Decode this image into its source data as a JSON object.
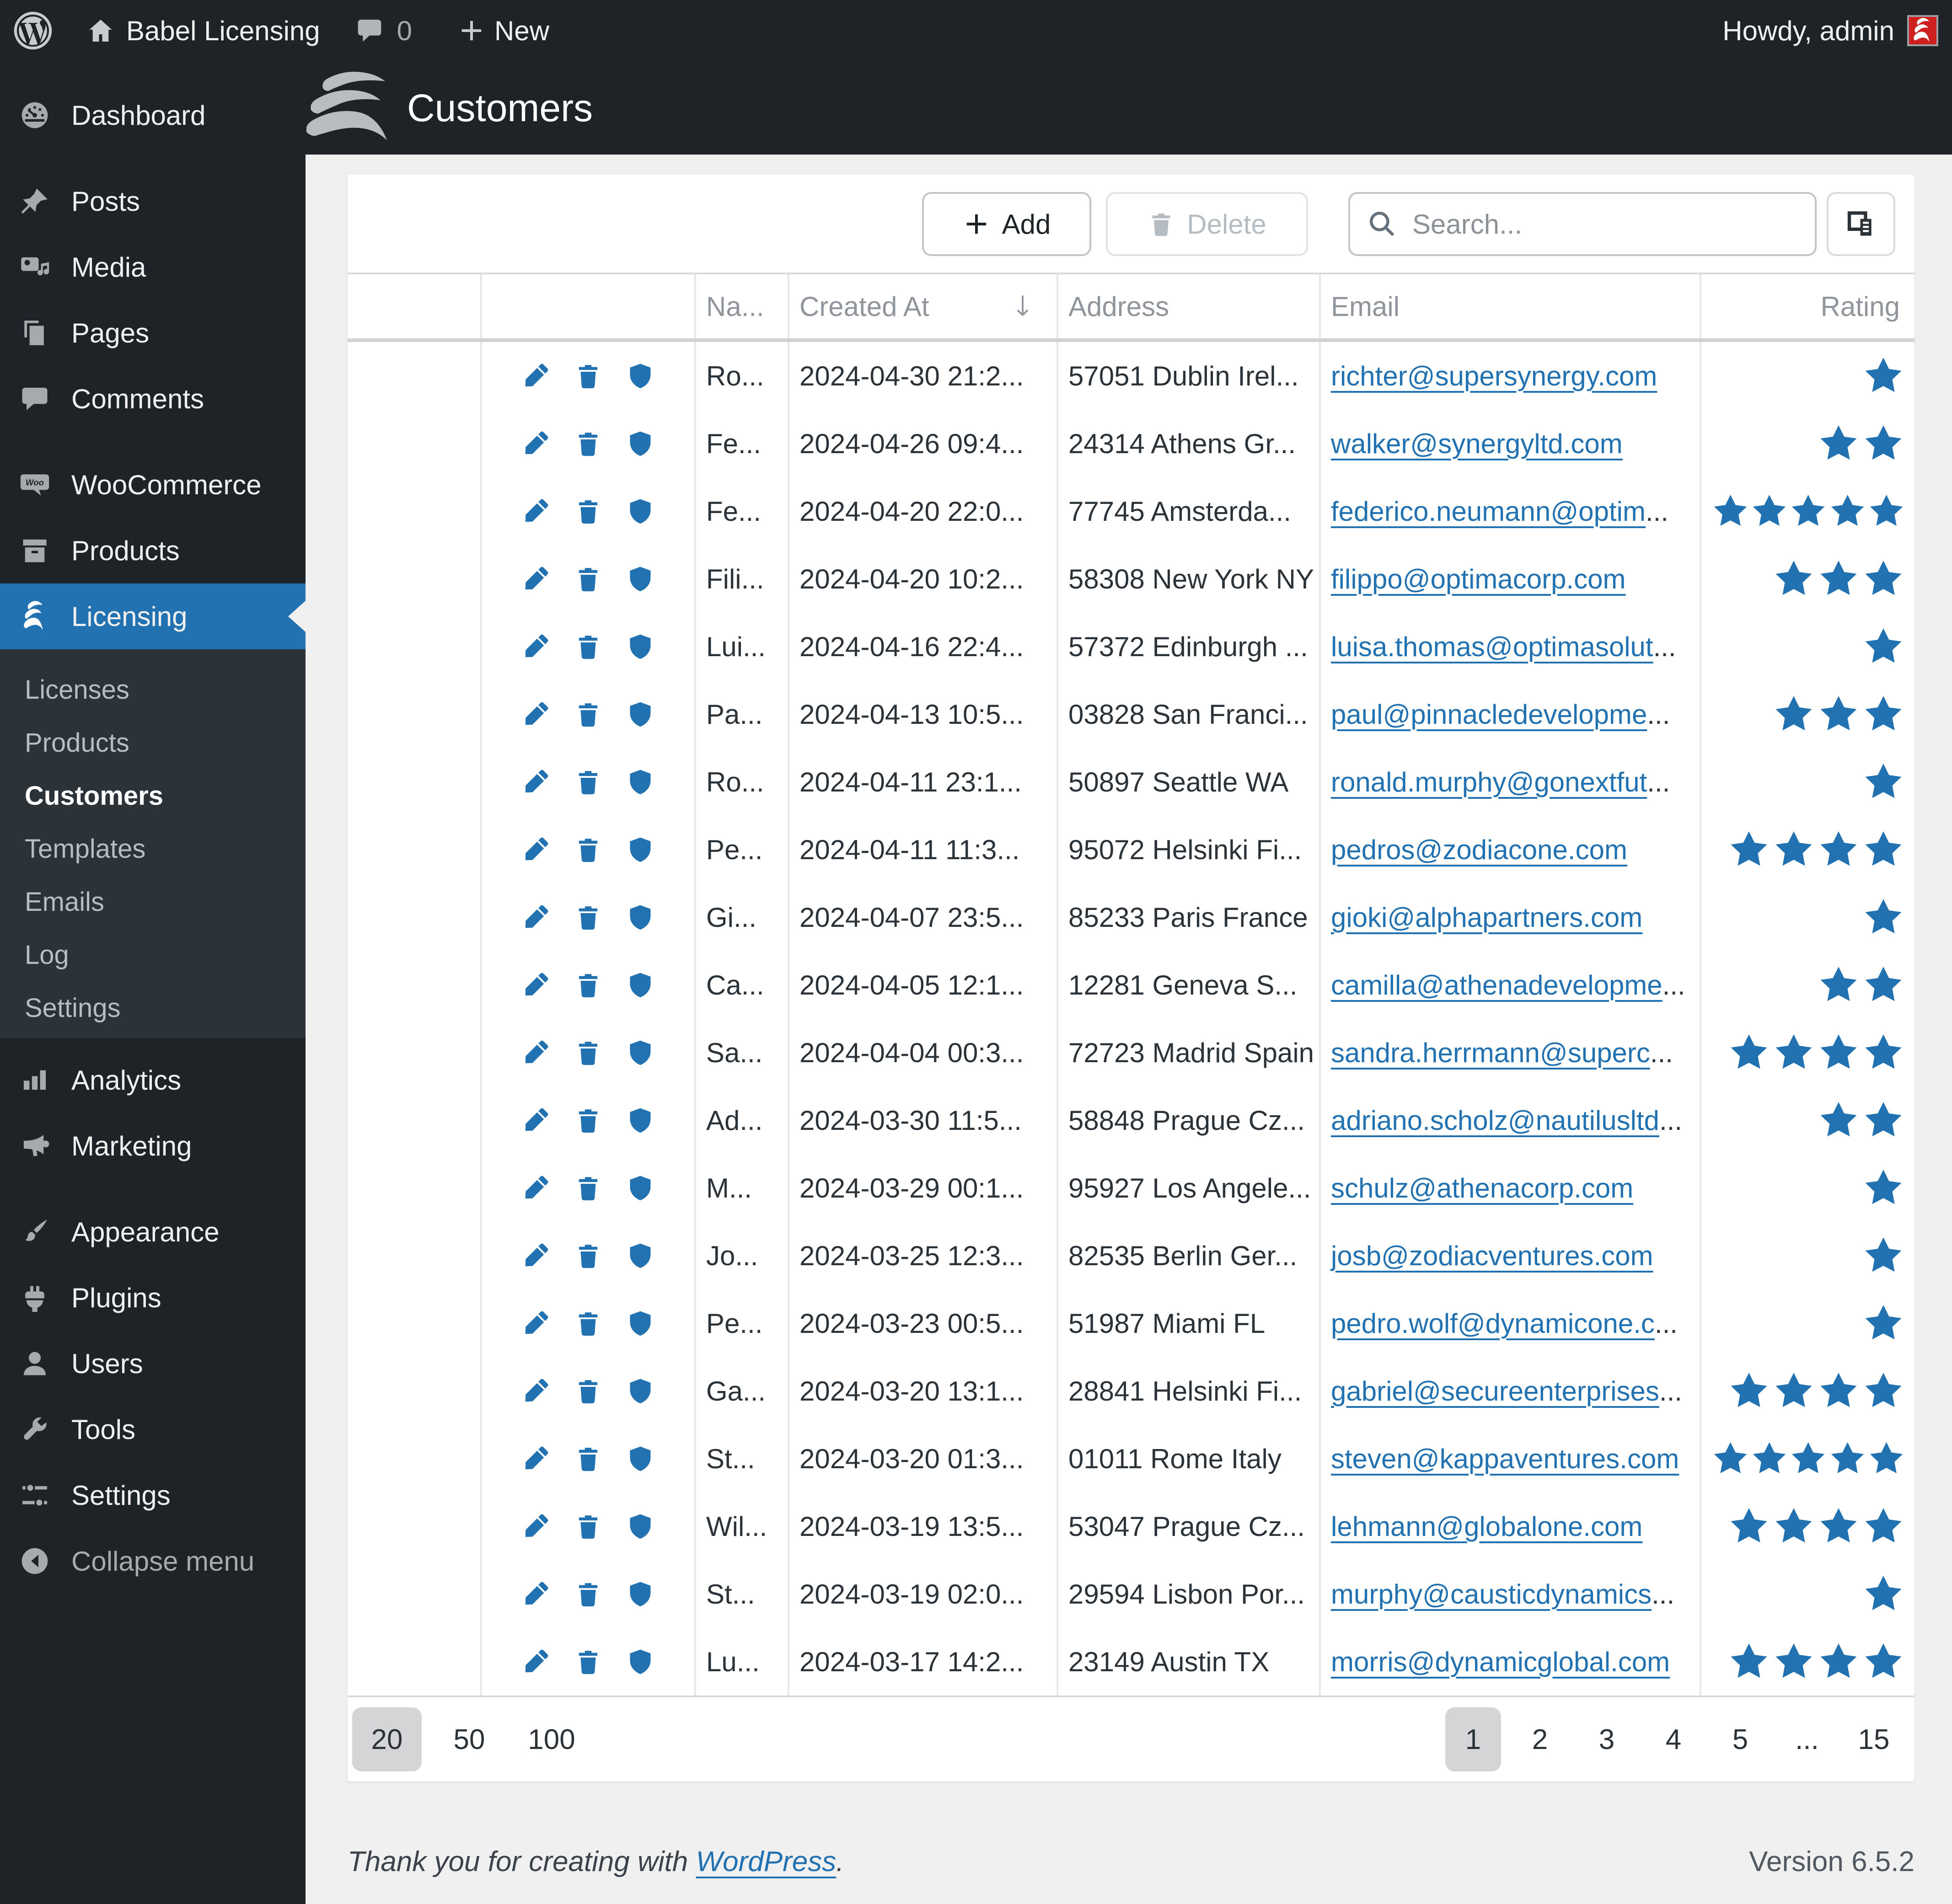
{
  "colors": {
    "accent": "#2271b1",
    "dark": "#1d2327",
    "submenu_bg": "#2c3338",
    "content_bg": "#f0f0f1",
    "link": "#2271b1",
    "star": "#2271b1",
    "avatar_red": "#cf2020"
  },
  "admin_bar": {
    "site_name": "Babel Licensing",
    "comments_count": "0",
    "new_label": "New",
    "howdy": "Howdy, admin"
  },
  "sidebar": {
    "items": [
      {
        "icon": "dashboard",
        "label": "Dashboard"
      },
      {
        "icon": "pushpin",
        "label": "Posts",
        "sep": true
      },
      {
        "icon": "media",
        "label": "Media"
      },
      {
        "icon": "pages",
        "label": "Pages"
      },
      {
        "icon": "comments",
        "label": "Comments"
      },
      {
        "icon": "woocommerce",
        "label": "WooCommerce",
        "sep": true
      },
      {
        "icon": "products",
        "label": "Products"
      },
      {
        "icon": "licensing",
        "label": "Licensing",
        "active": true,
        "submenu": [
          {
            "label": "Licenses"
          },
          {
            "label": "Products"
          },
          {
            "label": "Customers",
            "active": true
          },
          {
            "label": "Templates"
          },
          {
            "label": "Emails"
          },
          {
            "label": "Log"
          },
          {
            "label": "Settings"
          }
        ]
      },
      {
        "icon": "analytics",
        "label": "Analytics",
        "sep": true
      },
      {
        "icon": "marketing",
        "label": "Marketing"
      },
      {
        "icon": "appearance",
        "label": "Appearance",
        "sep": true
      },
      {
        "icon": "plugins",
        "label": "Plugins"
      },
      {
        "icon": "users",
        "label": "Users"
      },
      {
        "icon": "tools",
        "label": "Tools"
      },
      {
        "icon": "settings",
        "label": "Settings"
      }
    ],
    "collapse_label": "Collapse menu"
  },
  "header": {
    "title": "Customers"
  },
  "toolbar": {
    "add_label": "Add",
    "delete_label": "Delete",
    "search_placeholder": "Search..."
  },
  "table": {
    "ellipsis_char": "...",
    "columns": [
      "",
      "",
      "Na...",
      "Created At",
      "Address",
      "Email",
      "Rating"
    ],
    "sorted_column": "Created At",
    "rows": [
      {
        "name": "Ro...",
        "created": "2024-04-30 21:2...",
        "address": "57051 Dublin Irel...",
        "email": "richter@supersynergy.com",
        "email_truncated": false,
        "rating": 1
      },
      {
        "name": "Fe...",
        "created": "2024-04-26 09:4...",
        "address": "24314 Athens Gr...",
        "email": "walker@synergyltd.com",
        "email_truncated": false,
        "rating": 2
      },
      {
        "name": "Fe...",
        "created": "2024-04-20 22:0...",
        "address": "77745 Amsterda...",
        "email": "federico.neumann@optim",
        "email_truncated": true,
        "rating": 5
      },
      {
        "name": "Fili...",
        "created": "2024-04-20 10:2...",
        "address": "58308 New York NY",
        "email": "filippo@optimacorp.com",
        "email_truncated": false,
        "rating": 3
      },
      {
        "name": "Lui...",
        "created": "2024-04-16 22:4...",
        "address": "57372 Edinburgh ...",
        "email": "luisa.thomas@optimasolut",
        "email_truncated": true,
        "rating": 1
      },
      {
        "name": "Pa...",
        "created": "2024-04-13 10:5...",
        "address": "03828 San Franci...",
        "email": "paul@pinnacledevelopme",
        "email_truncated": true,
        "rating": 3
      },
      {
        "name": "Ro...",
        "created": "2024-04-11 23:1...",
        "address": "50897 Seattle WA",
        "email": "ronald.murphy@gonextfut",
        "email_truncated": true,
        "rating": 1
      },
      {
        "name": "Pe...",
        "created": "2024-04-11 11:3...",
        "address": "95072 Helsinki Fi...",
        "email": "pedros@zodiacone.com",
        "email_truncated": false,
        "rating": 4
      },
      {
        "name": "Gi...",
        "created": "2024-04-07 23:5...",
        "address": "85233 Paris France",
        "email": "gioki@alphapartners.com",
        "email_truncated": false,
        "rating": 1
      },
      {
        "name": "Ca...",
        "created": "2024-04-05 12:1...",
        "address": "12281 Geneva S...",
        "email": "camilla@athenadevelopme",
        "email_truncated": true,
        "rating": 2
      },
      {
        "name": "Sa...",
        "created": "2024-04-04 00:3...",
        "address": "72723 Madrid Spain",
        "email": "sandra.herrmann@superc",
        "email_truncated": true,
        "rating": 4
      },
      {
        "name": "Ad...",
        "created": "2024-03-30 11:5...",
        "address": "58848 Prague Cz...",
        "email": "adriano.scholz@nautilusltd",
        "email_truncated": true,
        "rating": 2
      },
      {
        "name": "M...",
        "created": "2024-03-29 00:1...",
        "address": "95927 Los Angele...",
        "email": "schulz@athenacorp.com",
        "email_truncated": false,
        "rating": 1
      },
      {
        "name": "Jo...",
        "created": "2024-03-25 12:3...",
        "address": "82535 Berlin Ger...",
        "email": "josb@zodiacventures.com",
        "email_truncated": false,
        "rating": 1
      },
      {
        "name": "Pe...",
        "created": "2024-03-23 00:5...",
        "address": "51987 Miami FL",
        "email": "pedro.wolf@dynamicone.c",
        "email_truncated": true,
        "rating": 1
      },
      {
        "name": "Ga...",
        "created": "2024-03-20 13:1...",
        "address": "28841 Helsinki Fi...",
        "email": "gabriel@secureenterprises",
        "email_truncated": true,
        "rating": 4
      },
      {
        "name": "St...",
        "created": "2024-03-20 01:3...",
        "address": "01011 Rome Italy",
        "email": "steven@kappaventures.com",
        "email_truncated": false,
        "rating": 5
      },
      {
        "name": "Wil...",
        "created": "2024-03-19 13:5...",
        "address": "53047 Prague Cz...",
        "email": "lehmann@globalone.com",
        "email_truncated": false,
        "rating": 4
      },
      {
        "name": "St...",
        "created": "2024-03-19 02:0...",
        "address": "29594 Lisbon Por...",
        "email": "murphy@causticdynamics",
        "email_truncated": true,
        "rating": 1
      },
      {
        "name": "Lu...",
        "created": "2024-03-17 14:2...",
        "address": "23149 Austin TX",
        "email": "morris@dynamicglobal.com",
        "email_truncated": false,
        "rating": 4
      }
    ]
  },
  "pagination": {
    "page_sizes": [
      "20",
      "50",
      "100"
    ],
    "active_size": "20",
    "pages": [
      "1",
      "2",
      "3",
      "4",
      "5",
      "...",
      "15"
    ],
    "active_page": "1"
  },
  "footer": {
    "thanks_prefix": "Thank you for creating with ",
    "wordpress_link": "WordPress",
    "thanks_suffix": ".",
    "version": "Version 6.5.2"
  }
}
